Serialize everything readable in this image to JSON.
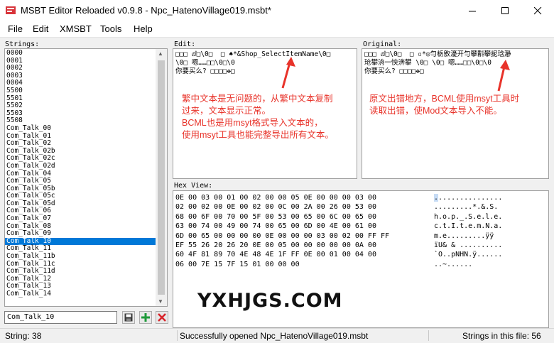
{
  "window": {
    "title": "MSBT Editor Reloaded v0.9.8 - Npc_HatenoVillage019.msbt*"
  },
  "menu": [
    "File",
    "Edit",
    "XMSBT",
    "Tools",
    "Help"
  ],
  "labels": {
    "strings": "Strings:",
    "edit": "Edit:",
    "original": "Original:",
    "hex_view": "Hex View:"
  },
  "strings_list": [
    "0000",
    "0001",
    "0002",
    "0003",
    "0004",
    "5500",
    "5501",
    "5502",
    "5503",
    "5508",
    "Com_Talk_00",
    "Com_Talk_01",
    "Com_Talk_02",
    "Com_Talk_02b",
    "Com_Talk_02c",
    "Com_Talk_02d",
    "Com_Talk_04",
    "Com_Talk_05",
    "Com_Talk_05b",
    "Com_Talk_05c",
    "Com_Talk_05d",
    "Com_Talk_06",
    "Com_Talk_07",
    "Com_Talk_08",
    "Com_Talk_09",
    "Com_Talk_10",
    "Com_Talk_11",
    "Com_Talk_11b",
    "Com_Talk_11c",
    "Com_Talk_11d",
    "Com_Talk_12",
    "Com_Talk_13",
    "Com_Talk_14"
  ],
  "selected_index": 25,
  "edit_text": "□□□ ⅆ□\\0□  □ ♠*&Shop_SelectItemName\\0□\n\\0□ 嗯……□□\\0□\\0\n你要买么? □□□□✥□",
  "original_text": "□□□ ⅆ□\\0□  □ ▫*◎勻栃敫瀀开勻攀斠攀抳琀瀞\n玱攀洀一怏渀攀 \\0□ \\0□ 嗯……□□\\0□\\0\n你要买么? □□□□✥□",
  "annotation_edit": [
    "繁中文本是无问题的，从繁中文本复制",
    "过来，文本显示正常。",
    "BCML也是用msyt格式导入文本的，",
    "使用msyt工具也能完整导出所有文本。"
  ],
  "annotation_original": [
    "原文出错地方，BCML使用msyt工具时",
    "读取出错，使Mod文本导入不能。"
  ],
  "hex_rows": [
    "0E 00 03 00 01 00 02 00 00 05 0E 00 00 00 03 00",
    "02 00 02 00 0E 00 02 00 0C 00 2A 00 26 00 53 00",
    "68 00 6F 00 70 00 5F 00 53 00 65 00 6C 00 65 00",
    "63 00 74 00 49 00 74 00 65 00 6D 00 4E 00 61 00",
    "6D 00 65 00 00 00 00 0E 00 00 00 03 00 02 00 FF FF",
    "EF 55 26 20 26 20 0E 00 05 00 00 00 00 00 0A 00",
    "60 4F 81 89 70 4E 48 4E 1F FF 0E 00 01 00 04 00",
    "06 00 7E 15 7F 15 01 00 00 00"
  ],
  "ascii_rows": [
    "...............",
    ".........*.&.S.",
    "h.o.p._.S.e.l.e.",
    "c.t.I.t.e.m.N.a.",
    "m.e.........ÿÿ",
    "ïU& & ..........",
    "`O..pNHN.ÿ......",
    "..~......"
  ],
  "watermark": "YXHJGS.COM",
  "name_input_value": "Com_Talk_10",
  "status": {
    "left": "String: 38",
    "center": "Successfully opened Npc_HatenoVillage019.msbt",
    "right": "Strings in this file: 56"
  },
  "colors": {
    "selection": "#0078d7",
    "annotation": "#e8332a",
    "add_green": "#1f9a3a",
    "delete_red": "#d8262c"
  }
}
